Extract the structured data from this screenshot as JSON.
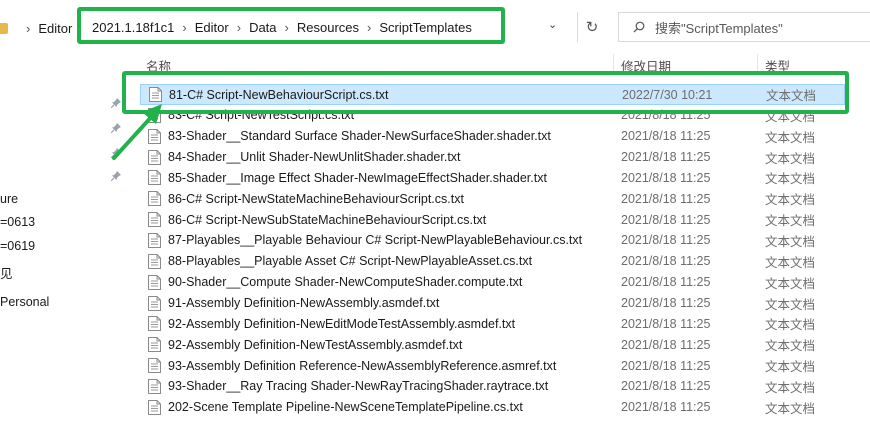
{
  "address": {
    "left_crumb": "Editor",
    "crumbs": [
      "2021.1.18f1c1",
      "Editor",
      "Data",
      "Resources",
      "ScriptTemplates"
    ],
    "search_placeholder": "搜索\"ScriptTemplates\""
  },
  "columns": {
    "name": "名称",
    "date": "修改日期",
    "type": "类型"
  },
  "nav": {
    "items": [
      "ure",
      "=0613",
      "=0619",
      "见",
      "Personal"
    ]
  },
  "files": [
    {
      "name": "81-C# Script-NewBehaviourScript.cs.txt",
      "date": "2022/7/30 10:21",
      "type": "文本文档",
      "selected": true
    },
    {
      "name": "83-C# Script-NewTestScript.cs.txt",
      "date": "2021/8/18 11:25",
      "type": "文本文档"
    },
    {
      "name": "83-Shader__Standard Surface Shader-NewSurfaceShader.shader.txt",
      "date": "2021/8/18 11:25",
      "type": "文本文档"
    },
    {
      "name": "84-Shader__Unlit Shader-NewUnlitShader.shader.txt",
      "date": "2021/8/18 11:25",
      "type": "文本文档"
    },
    {
      "name": "85-Shader__Image Effect Shader-NewImageEffectShader.shader.txt",
      "date": "2021/8/18 11:25",
      "type": "文本文档"
    },
    {
      "name": "86-C# Script-NewStateMachineBehaviourScript.cs.txt",
      "date": "2021/8/18 11:25",
      "type": "文本文档"
    },
    {
      "name": "86-C# Script-NewSubStateMachineBehaviourScript.cs.txt",
      "date": "2021/8/18 11:25",
      "type": "文本文档"
    },
    {
      "name": "87-Playables__Playable Behaviour C# Script-NewPlayableBehaviour.cs.txt",
      "date": "2021/8/18 11:25",
      "type": "文本文档"
    },
    {
      "name": "88-Playables__Playable Asset C# Script-NewPlayableAsset.cs.txt",
      "date": "2021/8/18 11:25",
      "type": "文本文档"
    },
    {
      "name": "90-Shader__Compute Shader-NewComputeShader.compute.txt",
      "date": "2021/8/18 11:25",
      "type": "文本文档"
    },
    {
      "name": "91-Assembly Definition-NewAssembly.asmdef.txt",
      "date": "2021/8/18 11:25",
      "type": "文本文档"
    },
    {
      "name": "92-Assembly Definition-NewEditModeTestAssembly.asmdef.txt",
      "date": "2021/8/18 11:25",
      "type": "文本文档"
    },
    {
      "name": "92-Assembly Definition-NewTestAssembly.asmdef.txt",
      "date": "2021/8/18 11:25",
      "type": "文本文档"
    },
    {
      "name": "93-Assembly Definition Reference-NewAssemblyReference.asmref.txt",
      "date": "2021/8/18 11:25",
      "type": "文本文档"
    },
    {
      "name": "93-Shader__Ray Tracing Shader-NewRayTracingShader.raytrace.txt",
      "date": "2021/8/18 11:25",
      "type": "文本文档"
    },
    {
      "name": "202-Scene Template Pipeline-NewSceneTemplatePipeline.cs.txt",
      "date": "2021/8/18 11:25",
      "type": "文本文档"
    }
  ],
  "colors": {
    "highlight": "#22b24c",
    "selection": "#cce8ff"
  }
}
